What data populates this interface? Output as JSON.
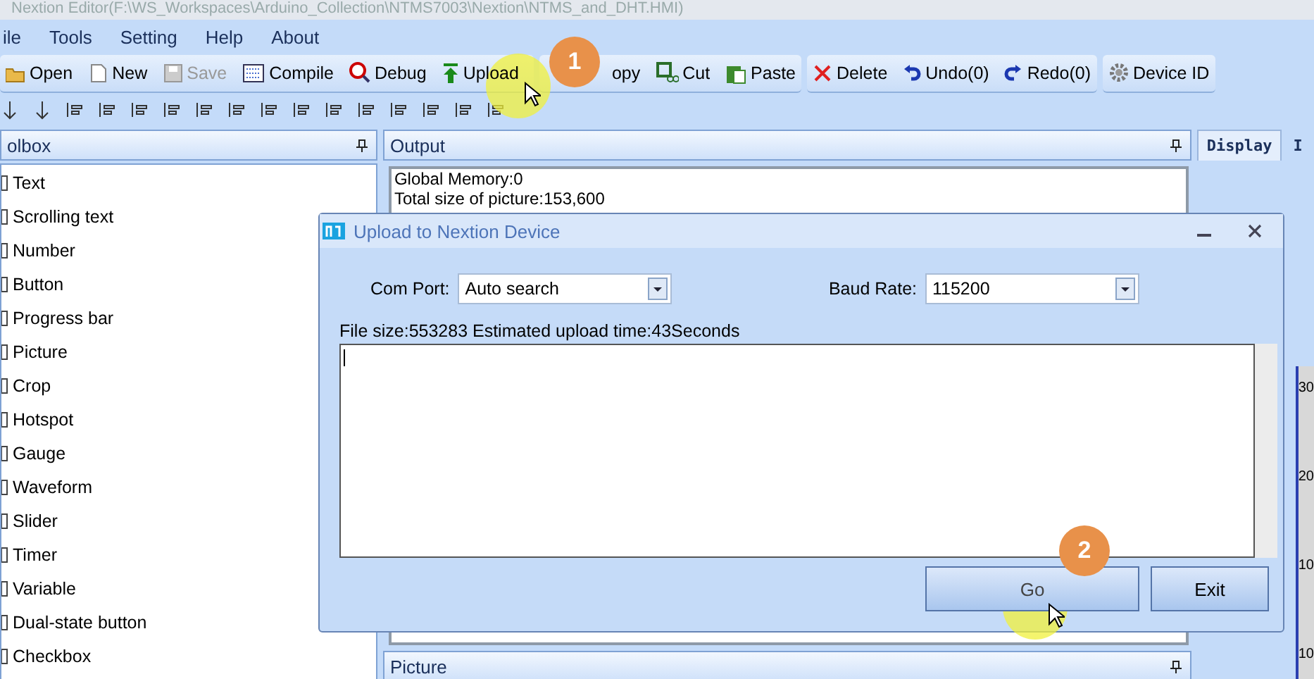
{
  "window": {
    "title": "Nextion  Editor(F:\\WS_Workspaces\\Arduino_Collection\\NTMS7003\\Nextion\\NTMS_and_DHT.HMI)"
  },
  "menu": [
    "ile",
    "Tools",
    "Setting",
    "Help",
    "About"
  ],
  "toolbar_groups": [
    [
      {
        "kind": "open",
        "label": "Open",
        "disabled": false
      },
      {
        "kind": "new",
        "label": "New",
        "disabled": false
      },
      {
        "kind": "save",
        "label": "Save",
        "disabled": true
      },
      {
        "kind": "compile",
        "label": "Compile",
        "disabled": false
      },
      {
        "kind": "debug",
        "label": "Debug",
        "disabled": false
      },
      {
        "kind": "upload",
        "label": "Upload",
        "disabled": false
      }
    ],
    [
      {
        "kind": "copy",
        "label": "opy",
        "disabled": false
      },
      {
        "kind": "cut",
        "label": "Cut",
        "disabled": false
      },
      {
        "kind": "paste",
        "label": "Paste",
        "disabled": false
      }
    ],
    [
      {
        "kind": "delete",
        "label": "Delete",
        "disabled": false
      },
      {
        "kind": "undo",
        "label": "Undo(0)",
        "disabled": false
      },
      {
        "kind": "redo",
        "label": "Redo(0)",
        "disabled": false
      }
    ],
    [
      {
        "kind": "device",
        "label": "Device  ID",
        "disabled": false
      }
    ]
  ],
  "toolbox": {
    "title": "olbox",
    "items": [
      "Text",
      "Scrolling text",
      "Number",
      "Button",
      "Progress bar",
      "Picture",
      "Crop",
      "Hotspot",
      "Gauge",
      "Waveform",
      "Slider",
      "Timer",
      "Variable",
      "Dual-state button",
      "Checkbox"
    ]
  },
  "output": {
    "title": "Output",
    "lines": [
      "Global Memory:0",
      "Total size of picture:153,600"
    ]
  },
  "picture_panel": {
    "title": "Picture"
  },
  "right_tabs": [
    {
      "label": "Display",
      "selected": true
    },
    {
      "label": "I",
      "selected": false
    }
  ],
  "canvas_ticks": [
    "30",
    "20",
    "10",
    "10"
  ],
  "dialog": {
    "title": "Upload to Nextion Device",
    "com_port": {
      "label": "Com Port:",
      "value": "Auto search"
    },
    "baud_rate": {
      "label": "Baud Rate:",
      "value": "115200"
    },
    "info": "File size:553283 Estimated upload time:43Seconds",
    "buttons": [
      "Go",
      "Exit"
    ]
  },
  "markers": [
    "1",
    "2"
  ]
}
